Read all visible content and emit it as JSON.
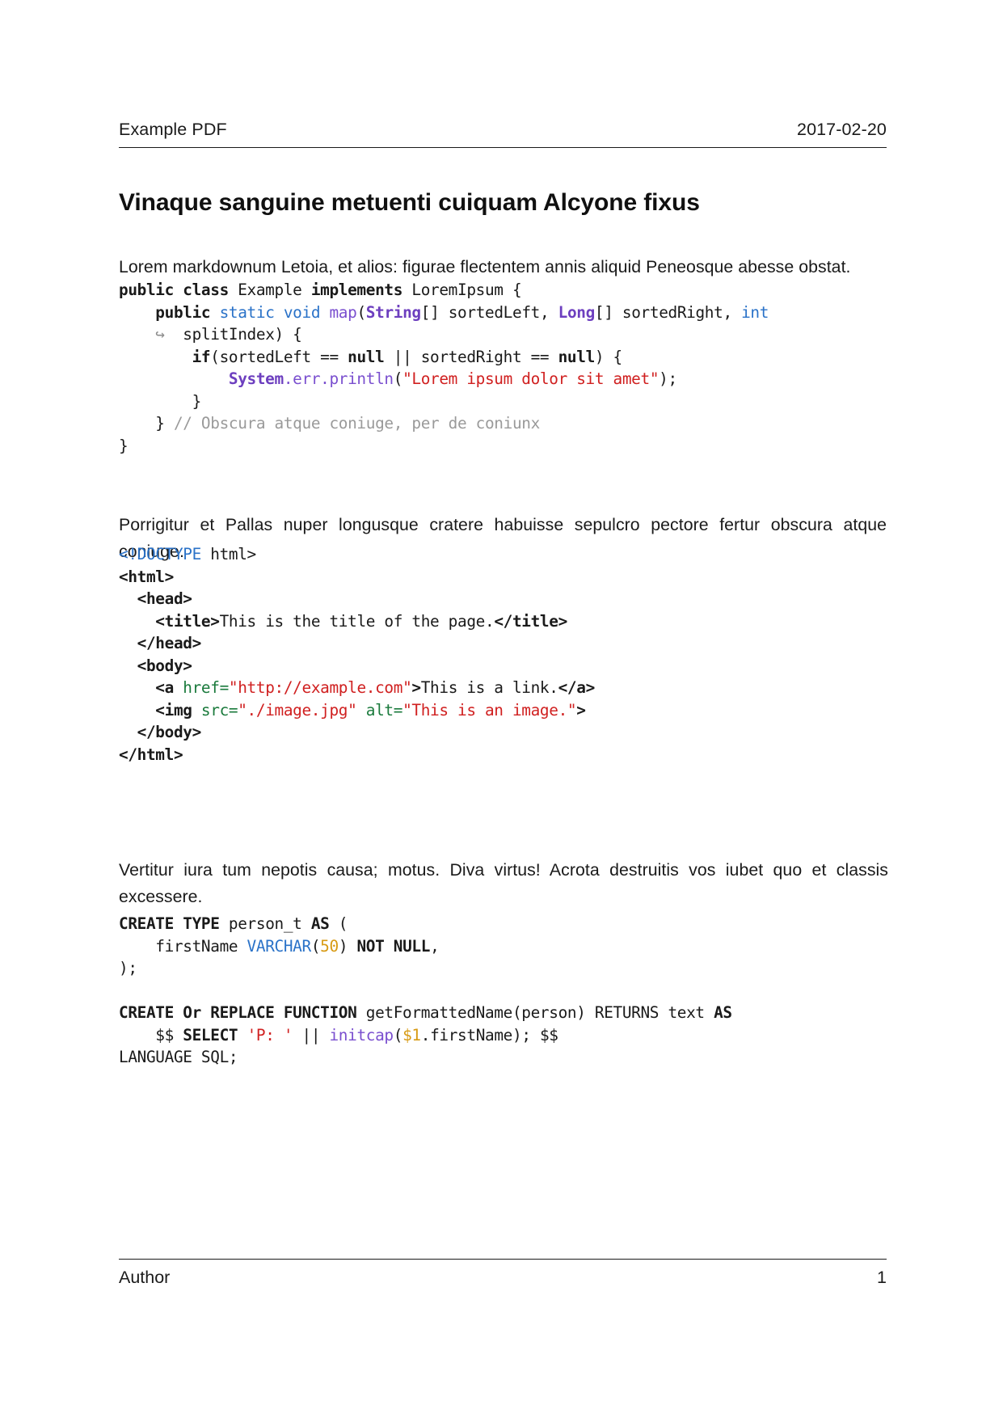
{
  "header": {
    "left": "Example PDF",
    "right": "2017-02-20"
  },
  "title": "Vinaque sanguine metuenti cuiquam Alcyone fixus",
  "paragraphs": {
    "p1": "Lorem markdownum Letoia, et alios: figurae flectentem annis aliquid Peneosque abesse obstat.",
    "p2": "Porrigitur et Pallas nuper longusque cratere habuisse sepulcro pectore fertur obscura atque coniuge.",
    "p3": "Vertitur iura tum nepotis causa; motus.  Diva virtus!  Acrota destruitis vos iubet quo et classis excessere."
  },
  "code_java": {
    "language": "java",
    "lines": [
      [
        {
          "text": "public class",
          "style": "kw"
        },
        {
          "text": " Example ",
          "style": "plain"
        },
        {
          "text": "implements",
          "style": "kw"
        },
        {
          "text": " LoremIpsum {",
          "style": "plain"
        }
      ],
      [
        {
          "text": "    ",
          "style": "plain"
        },
        {
          "text": "public",
          "style": "kw"
        },
        {
          "text": " ",
          "style": "plain"
        },
        {
          "text": "static void",
          "style": "type"
        },
        {
          "text": " ",
          "style": "plain"
        },
        {
          "text": "map",
          "style": "fn"
        },
        {
          "text": "(",
          "style": "plain"
        },
        {
          "text": "String",
          "style": "class"
        },
        {
          "text": "[] sortedLeft, ",
          "style": "plain"
        },
        {
          "text": "Long",
          "style": "class"
        },
        {
          "text": "[] sortedRight, ",
          "style": "plain"
        },
        {
          "text": "int",
          "style": "type"
        }
      ],
      [
        {
          "text": "    ↪ ",
          "style": "wrap"
        },
        {
          "text": " splitIndex) {",
          "style": "plain"
        }
      ],
      [
        {
          "text": "        ",
          "style": "plain"
        },
        {
          "text": "if",
          "style": "kw"
        },
        {
          "text": "(sortedLeft == ",
          "style": "plain"
        },
        {
          "text": "null",
          "style": "kw"
        },
        {
          "text": " || sortedRight == ",
          "style": "plain"
        },
        {
          "text": "null",
          "style": "kw"
        },
        {
          "text": ") {",
          "style": "plain"
        }
      ],
      [
        {
          "text": "            ",
          "style": "plain"
        },
        {
          "text": "System",
          "style": "class"
        },
        {
          "text": ".err.println",
          "style": "fn"
        },
        {
          "text": "(",
          "style": "plain"
        },
        {
          "text": "\"Lorem ipsum dolor sit amet\"",
          "style": "str"
        },
        {
          "text": ");",
          "style": "plain"
        }
      ],
      [
        {
          "text": "        }",
          "style": "plain"
        }
      ],
      [
        {
          "text": "    } ",
          "style": "plain"
        },
        {
          "text": "// Obscura atque coniuge, per de coniunx",
          "style": "comment"
        }
      ],
      [
        {
          "text": "}",
          "style": "plain"
        }
      ]
    ]
  },
  "code_html": {
    "language": "html",
    "lines": [
      [
        {
          "text": "<!DOCTYPE",
          "style": "doctype"
        },
        {
          "text": " html>",
          "style": "plain"
        }
      ],
      [
        {
          "text": "<html>",
          "style": "tag"
        }
      ],
      [
        {
          "text": "  ",
          "style": "plain"
        },
        {
          "text": "<head>",
          "style": "tag"
        }
      ],
      [
        {
          "text": "    ",
          "style": "plain"
        },
        {
          "text": "<title>",
          "style": "tag"
        },
        {
          "text": "This is the title of the page.",
          "style": "plain"
        },
        {
          "text": "</title>",
          "style": "tag"
        }
      ],
      [
        {
          "text": "  ",
          "style": "plain"
        },
        {
          "text": "</head>",
          "style": "tag"
        }
      ],
      [
        {
          "text": "  ",
          "style": "plain"
        },
        {
          "text": "<body>",
          "style": "tag"
        }
      ],
      [
        {
          "text": "    ",
          "style": "plain"
        },
        {
          "text": "<a",
          "style": "tag"
        },
        {
          "text": " ",
          "style": "plain"
        },
        {
          "text": "href=",
          "style": "attr"
        },
        {
          "text": "\"http://example.com\"",
          "style": "str"
        },
        {
          "text": ">",
          "style": "tag"
        },
        {
          "text": "This is a link.",
          "style": "plain"
        },
        {
          "text": "</a>",
          "style": "tag"
        }
      ],
      [
        {
          "text": "    ",
          "style": "plain"
        },
        {
          "text": "<img",
          "style": "tag"
        },
        {
          "text": " ",
          "style": "plain"
        },
        {
          "text": "src=",
          "style": "attr"
        },
        {
          "text": "\"./image.jpg\"",
          "style": "str"
        },
        {
          "text": " ",
          "style": "plain"
        },
        {
          "text": "alt=",
          "style": "attr"
        },
        {
          "text": "\"This is an image.\"",
          "style": "str"
        },
        {
          "text": ">",
          "style": "tag"
        }
      ],
      [
        {
          "text": "  ",
          "style": "plain"
        },
        {
          "text": "</body>",
          "style": "tag"
        }
      ],
      [
        {
          "text": "</html>",
          "style": "tag"
        }
      ]
    ]
  },
  "code_sql": {
    "language": "sql",
    "lines": [
      [
        {
          "text": "CREATE TYPE",
          "style": "kw"
        },
        {
          "text": " person_t ",
          "style": "plain"
        },
        {
          "text": "AS",
          "style": "kw"
        },
        {
          "text": " (",
          "style": "plain"
        }
      ],
      [
        {
          "text": "    firstName ",
          "style": "plain"
        },
        {
          "text": "VARCHAR",
          "style": "type"
        },
        {
          "text": "(",
          "style": "plain"
        },
        {
          "text": "50",
          "style": "num"
        },
        {
          "text": ") ",
          "style": "plain"
        },
        {
          "text": "NOT NULL",
          "style": "kw"
        },
        {
          "text": ",",
          "style": "plain"
        }
      ],
      [
        {
          "text": ");",
          "style": "plain"
        }
      ],
      [
        {
          "text": " ",
          "style": "plain"
        }
      ],
      [
        {
          "text": "CREATE Or REPLACE FUNCTION",
          "style": "kw"
        },
        {
          "text": " getFormattedName(person) RETURNS text ",
          "style": "plain"
        },
        {
          "text": "AS",
          "style": "kw"
        }
      ],
      [
        {
          "text": "    $$ ",
          "style": "plain"
        },
        {
          "text": "SELECT",
          "style": "kw"
        },
        {
          "text": " ",
          "style": "plain"
        },
        {
          "text": "'P: '",
          "style": "str"
        },
        {
          "text": " || ",
          "style": "plain"
        },
        {
          "text": "initcap",
          "style": "fn"
        },
        {
          "text": "(",
          "style": "plain"
        },
        {
          "text": "$1",
          "style": "num"
        },
        {
          "text": ".firstName); $$",
          "style": "plain"
        }
      ],
      [
        {
          "text": "LANGUAGE SQL;",
          "style": "plain"
        }
      ]
    ]
  },
  "footer": {
    "left": "Author",
    "right": "1"
  },
  "colors": {
    "text": "#1a1a1a",
    "keyword": "#1a1a1a",
    "type": "#2a72c8",
    "class": "#6d3fbf",
    "function": "#7a4fcf",
    "string": "#d02020",
    "comment": "#9a9a9a",
    "attribute": "#1a7a3c",
    "number": "#d79a13",
    "rule": "#1a1a1a"
  }
}
